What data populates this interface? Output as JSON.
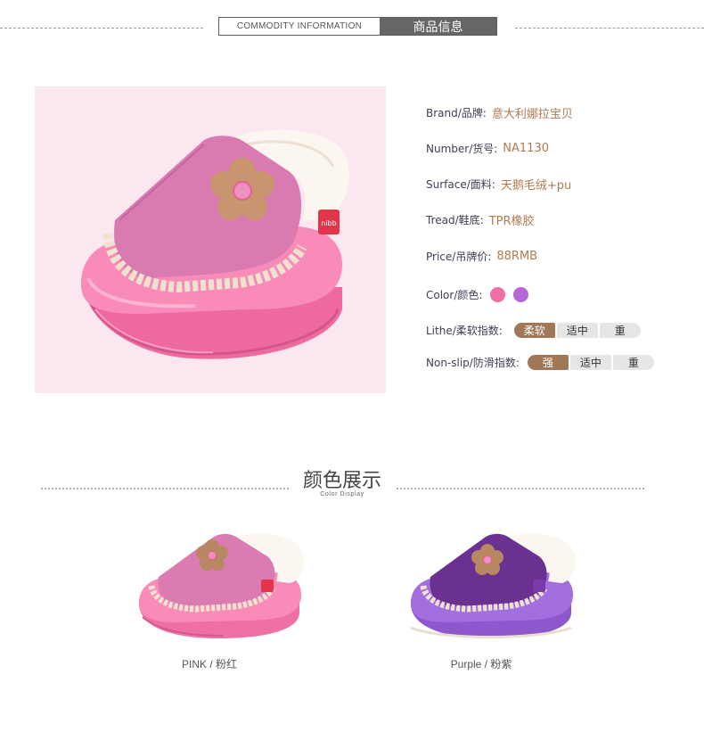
{
  "header": {
    "en_label": "COMMODITY INFORMATION",
    "cn_label": "商品信息"
  },
  "specs": {
    "brand": {
      "key": "Brand/品牌:",
      "value": "意大利娜拉宝贝"
    },
    "number": {
      "key": "Number/货号:",
      "value": "NA1130"
    },
    "surface": {
      "key": "Surface/面料:",
      "value": "天鹅毛绒+pu"
    },
    "tread": {
      "key": "Tread/鞋底:",
      "value": "TPR橡胶"
    },
    "price": {
      "key": "Price/吊牌价:",
      "value": "88RMB"
    },
    "color": {
      "key": "Color/颜色:",
      "swatches": [
        "#ee6fa8",
        "#b768d6"
      ]
    },
    "lithe": {
      "key": "Lithe/柔软指数:",
      "levels": [
        "柔软",
        "适中",
        "重"
      ],
      "selected": 0
    },
    "nonslip": {
      "key": "Non-slip/防滑指数:",
      "levels": [
        "强",
        "适中",
        "重"
      ],
      "selected": 0
    }
  },
  "color_display": {
    "title": "颜色展示",
    "subtitle": "Color Display",
    "items": [
      {
        "caption": "PINK / 粉红",
        "color": "pink"
      },
      {
        "caption": "Purple / 粉紫",
        "color": "purple"
      }
    ]
  },
  "colors": {
    "accent_brown": "#a07857",
    "value_text": "#b07a50",
    "pink_body": "#f47bab",
    "purple_body": "#9a62d6"
  },
  "icons": {
    "shoe_label": "nibb"
  }
}
